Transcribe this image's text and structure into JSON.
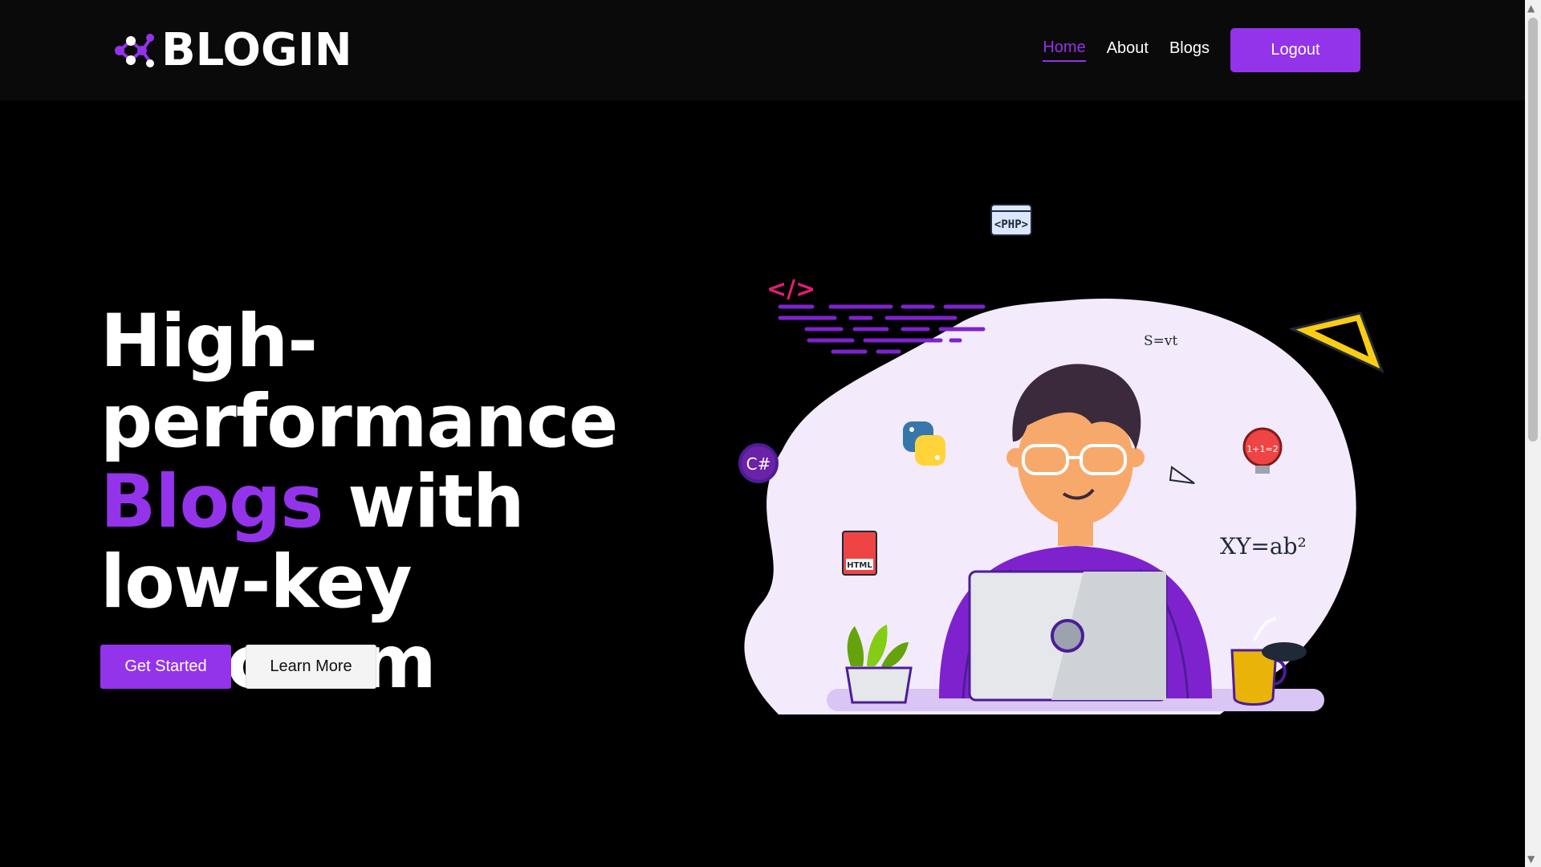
{
  "brand": {
    "name": "BLOGIN"
  },
  "nav": {
    "links": [
      {
        "label": "Home",
        "active": true
      },
      {
        "label": "About",
        "active": false
      },
      {
        "label": "Blogs",
        "active": false
      }
    ],
    "logout_label": "Logout"
  },
  "hero": {
    "title_part1": "High-performance ",
    "title_accent": "Blogs",
    "title_part2": " with low-key sarcasm",
    "primary_cta": "Get Started",
    "secondary_cta": "Learn More"
  },
  "illustration": {
    "badges": [
      "<PHP>",
      "</>",
      "C#",
      "HTML"
    ],
    "formulas": [
      "S=vt",
      "XY=ab²",
      "1+1=2"
    ]
  },
  "colors": {
    "accent": "#9333ea",
    "navbar_bg": "#0a0a0a",
    "page_bg": "#000000"
  }
}
